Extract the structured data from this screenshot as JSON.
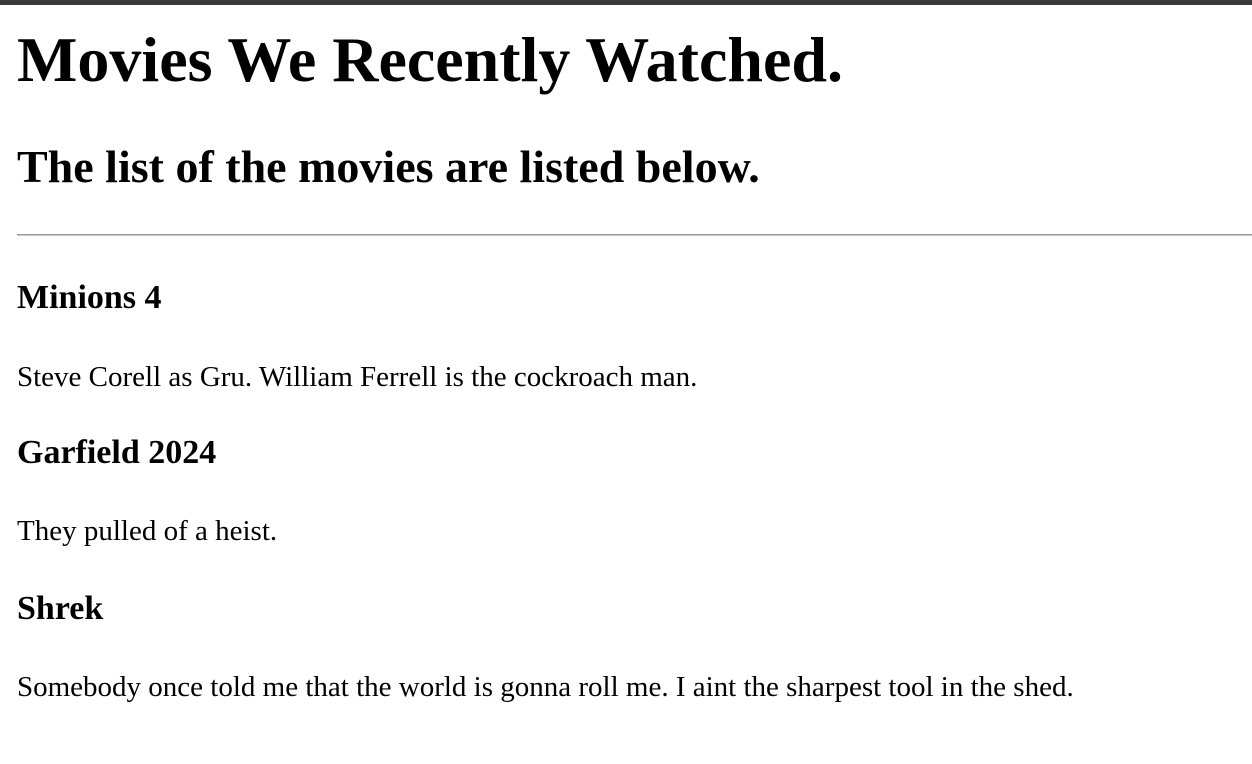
{
  "page": {
    "title": "Movies We Recently Watched.",
    "subtitle": "The list of the movies are listed below."
  },
  "movies": [
    {
      "title": "Minions 4",
      "description": "Steve Corell as Gru. William Ferrell is the cockroach man."
    },
    {
      "title": "Garfield 2024",
      "description": "They pulled of a heist."
    },
    {
      "title": "Shrek",
      "description": "Somebody once told me that the world is gonna roll me. I aint the sharpest tool in the shed."
    }
  ]
}
